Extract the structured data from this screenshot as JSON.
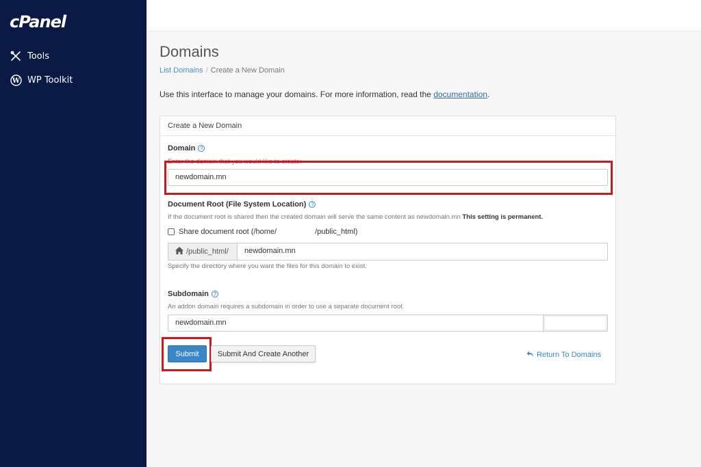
{
  "sidebar": {
    "logo": "cPanel",
    "items": [
      {
        "label": "Tools",
        "icon": "tools-icon"
      },
      {
        "label": "WP Toolkit",
        "icon": "wordpress-icon"
      }
    ]
  },
  "header": {
    "title": "Domains",
    "breadcrumb": [
      "List Domains",
      "Create a New Domain"
    ]
  },
  "intro": {
    "text": "Use this interface to manage your domains. For more information, read the ",
    "link": "documentation",
    "end": "."
  },
  "panel": {
    "heading": "Create a New Domain",
    "domain": {
      "label": "Domain",
      "description": "Enter the domain that you would like to create:",
      "value": "newdomain.mn"
    },
    "docroot": {
      "label": "Document Root (File System Location)",
      "description": "If the document root is shared then the created domain will serve the same content as newdomain.mn",
      "permanent": "This setting is permanent.",
      "share_label_prefix": "Share document root (/home/",
      "share_label_suffix": "/public_html)",
      "prefix": "/public_html/",
      "value": "newdomain.mn",
      "hint": "Specify the directory where you want the files for this domain to exist."
    },
    "subdomain": {
      "label": "Subdomain",
      "description": "An addon domain requires a subdomain in order to use a separate document root.",
      "value": "newdomain.mn",
      "suffix": ""
    },
    "buttons": {
      "submit": "Submit",
      "submit_another": "Submit And Create Another",
      "return": "Return To Domains"
    }
  },
  "colors": {
    "sidebar": "#0b1a44",
    "accent": "#3a86c8",
    "highlight": "#d0161d"
  }
}
